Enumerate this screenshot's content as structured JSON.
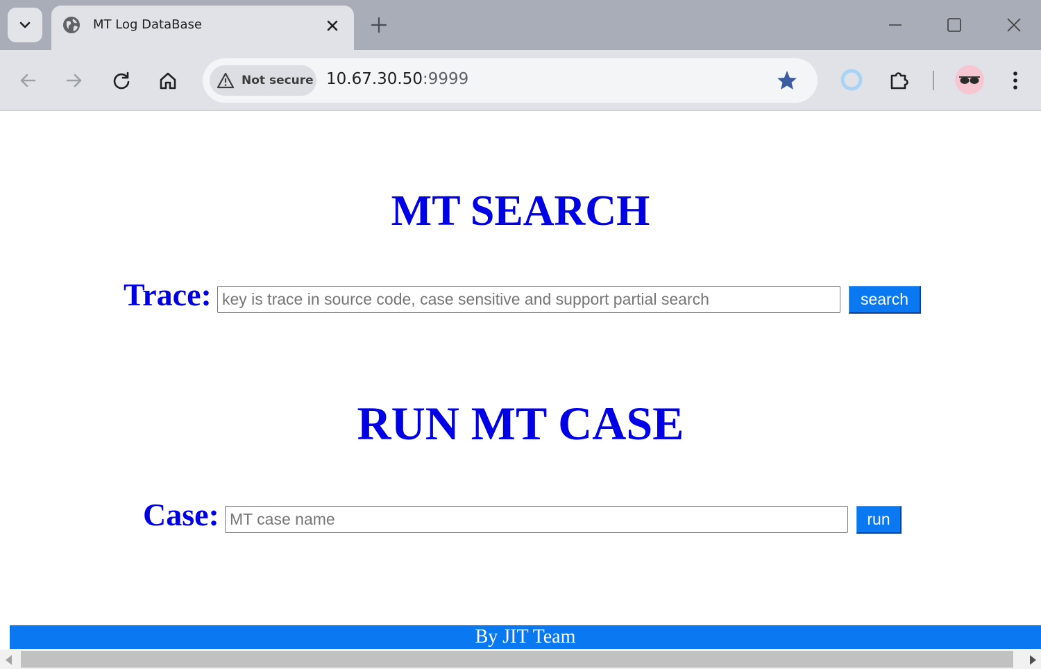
{
  "browser": {
    "tab_title": "MT Log DataBase",
    "security_label": "Not secure",
    "url_host": "10.67.30.50",
    "url_port": ":9999"
  },
  "page": {
    "search_heading": "MT SEARCH",
    "trace_label": "Trace:",
    "trace_placeholder": "key is trace in source code, case sensitive and support partial search",
    "search_button": "search",
    "run_heading": "RUN MT CASE",
    "case_label": "Case:",
    "case_placeholder": "MT case name",
    "run_button": "run",
    "footer": "By JIT Team"
  },
  "colors": {
    "heading": "#0000e6",
    "button": "#0a78f0",
    "footer_bg": "#0a78f0"
  },
  "icons": [
    "tab-search-dropdown-icon",
    "globe-icon",
    "close-icon",
    "plus-icon",
    "minimize-icon",
    "maximize-icon",
    "window-close-icon",
    "back-arrow-icon",
    "forward-arrow-icon",
    "reload-icon",
    "home-icon",
    "warning-icon",
    "star-icon",
    "extension-ring-icon",
    "puzzle-icon",
    "profile-avatar-icon",
    "more-menu-icon"
  ]
}
